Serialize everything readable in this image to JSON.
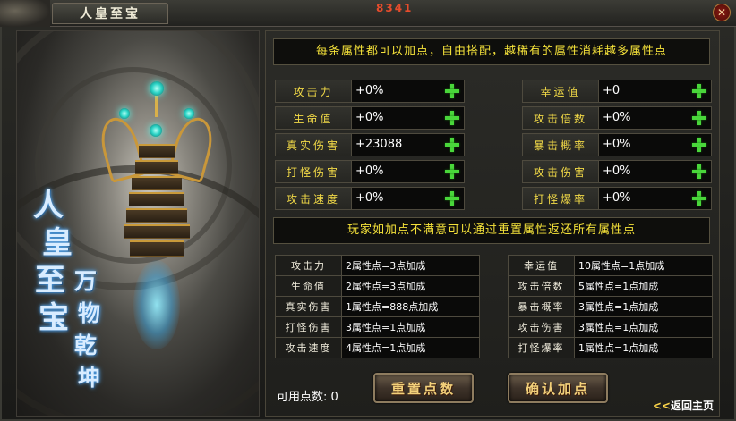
{
  "window": {
    "title": "人皇至宝",
    "top_red_text": "8341"
  },
  "art": {
    "calligraphy_main": [
      "人",
      "皇",
      "至",
      "宝"
    ],
    "calligraphy_side": [
      "万",
      "物",
      "乾",
      "坤"
    ]
  },
  "notice_top": "每条属性都可以加点，自由搭配，越稀有的属性消耗越多属性点",
  "attributes_left": [
    {
      "label": "攻击力",
      "value": "+0%"
    },
    {
      "label": "生命值",
      "value": "+0%"
    },
    {
      "label": "真实伤害",
      "value": "+23088"
    },
    {
      "label": "打怪伤害",
      "value": "+0%"
    },
    {
      "label": "攻击速度",
      "value": "+0%"
    }
  ],
  "attributes_right": [
    {
      "label": "幸运值",
      "value": "+0"
    },
    {
      "label": "攻击倍数",
      "value": "+0%"
    },
    {
      "label": "暴击概率",
      "value": "+0%"
    },
    {
      "label": "攻击伤害",
      "value": "+0%"
    },
    {
      "label": "打怪爆率",
      "value": "+0%"
    }
  ],
  "notice_mid": "玩家如加点不满意可以通过重置属性返还所有属性点",
  "rules_left": [
    {
      "label": "攻击力",
      "value": "2属性点=3点加成"
    },
    {
      "label": "生命值",
      "value": "2属性点=3点加成"
    },
    {
      "label": "真实伤害",
      "value": "1属性点=888点加成"
    },
    {
      "label": "打怪伤害",
      "value": "3属性点=1点加成"
    },
    {
      "label": "攻击速度",
      "value": "4属性点=1点加成"
    }
  ],
  "rules_right": [
    {
      "label": "幸运值",
      "value": "10属性点=1点加成"
    },
    {
      "label": "攻击倍数",
      "value": "5属性点=1点加成"
    },
    {
      "label": "暴击概率",
      "value": "3属性点=1点加成"
    },
    {
      "label": "攻击伤害",
      "value": "3属性点=1点加成"
    },
    {
      "label": "打怪爆率",
      "value": "1属性点=1点加成"
    }
  ],
  "footer": {
    "points_label": "可用点数: 0",
    "reset_button": "重置点数",
    "confirm_button": "确认加点",
    "back_arrows": "<<",
    "back_label": "返回主页"
  },
  "colors": {
    "notice_text": "#f5e23a",
    "label_text": "#f1d947",
    "plus_green": "#49d63a",
    "button_text": "#f2d07a"
  }
}
